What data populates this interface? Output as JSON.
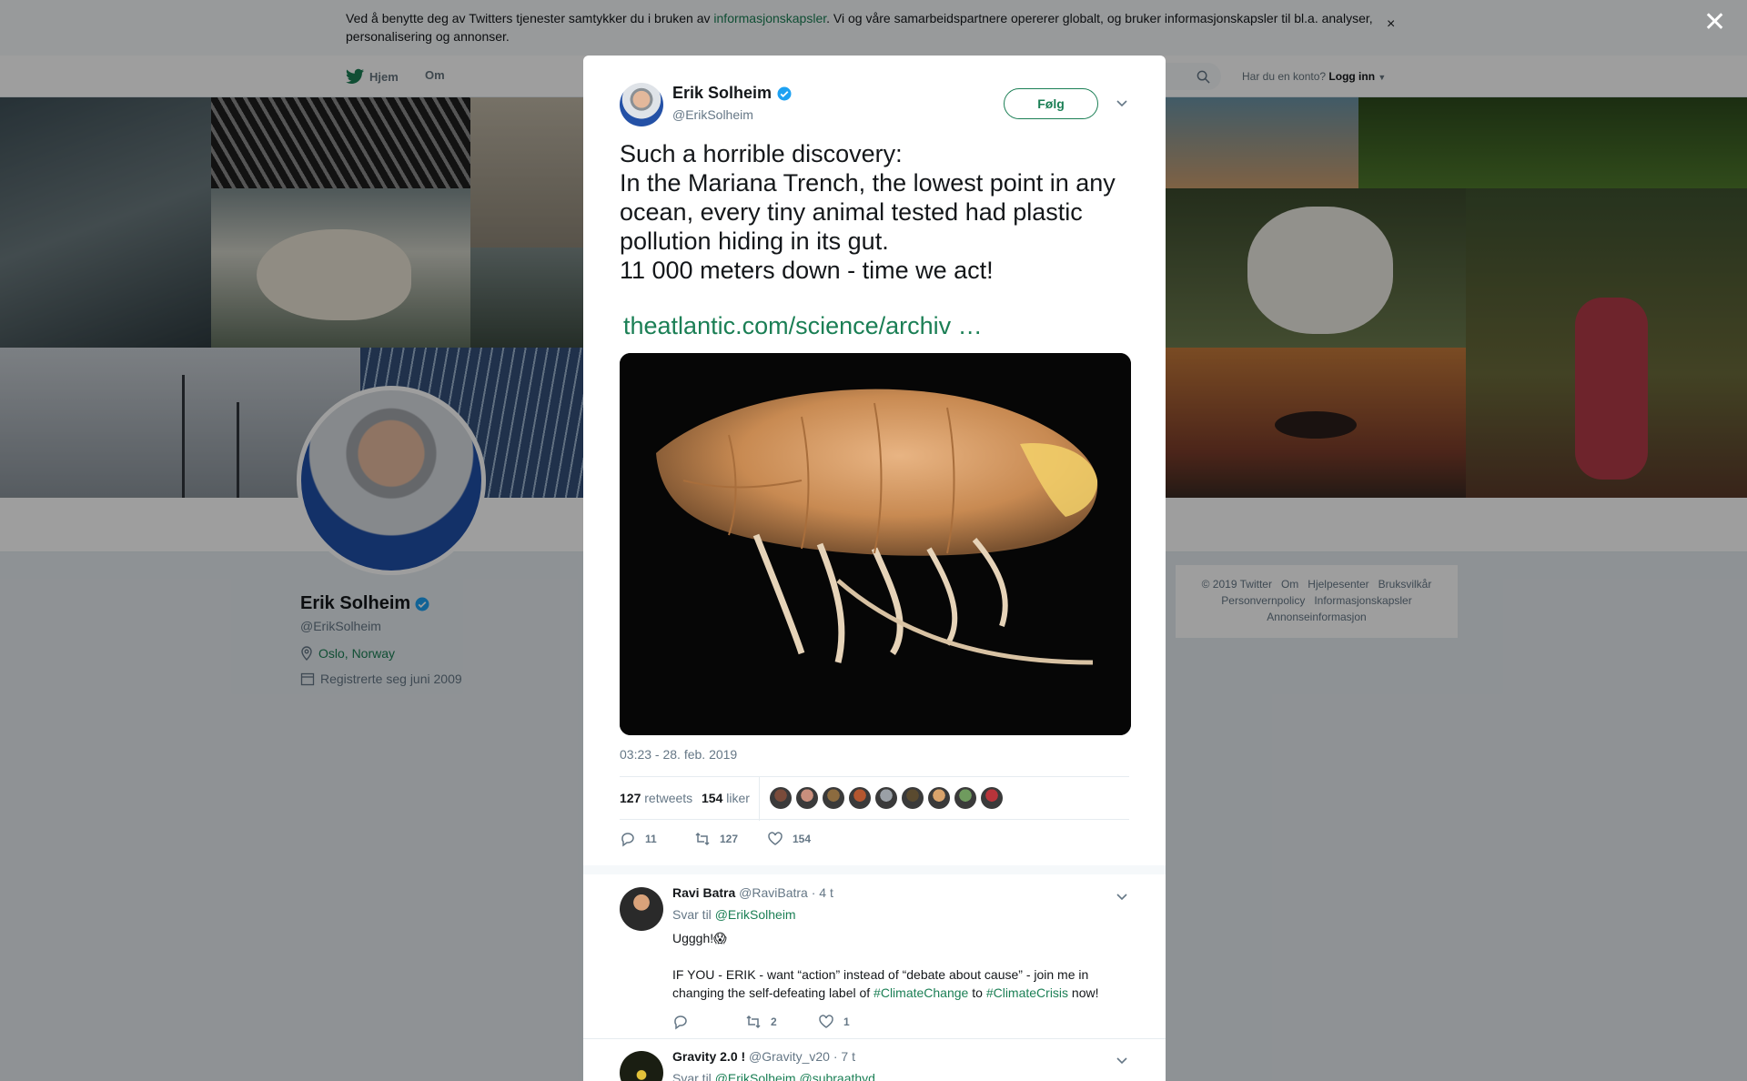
{
  "cookie": {
    "text_before": "Ved å benytte deg av Twitters tjenester samtykker du i bruken av ",
    "link": "informasjonskapsler",
    "text_after": ". Vi og våre samarbeidspartnere opererer globalt, og bruker informasjonskapsler til bl.a. analyser, personalisering og annonser.",
    "close": "×"
  },
  "nav": {
    "home": "Hjem",
    "about": "Om",
    "login_prompt": "Har du en konto?",
    "login": "Logg inn"
  },
  "profile": {
    "name": "Erik Solheim",
    "handle": "@ErikSolheim",
    "location": "Oslo, Norway",
    "joined": "Registrerte seg juni 2009"
  },
  "footer": {
    "links": [
      "© 2019 Twitter",
      "Om",
      "Hjelpesenter",
      "Bruksvilkår",
      "Personvernpolicy",
      "Informasjonskapsler",
      "Annonseinformasjon"
    ]
  },
  "overlay_close": "✕",
  "tweet": {
    "author_name": "Erik Solheim",
    "author_handle": "@ErikSolheim",
    "follow_label": "Følg",
    "text": "Such a horrible discovery:\nIn the Mariana Trench, the lowest point in any ocean, every tiny animal tested had plastic pollution hiding in its gut.\n11 000 meters down - time we act!",
    "link": "theatlantic.com/science/archiv  …",
    "timestamp": "03:23 - 28. feb. 2019",
    "retweets_count": "127",
    "retweets_label": "retweets",
    "likes_count": "154",
    "likes_label": "liker",
    "likers_colors": [
      "#7a4b3a",
      "#c98f7d",
      "#8c6b3f",
      "#b4562f",
      "#9aa0a6",
      "#5a4a2f",
      "#d9a36b",
      "#6f9b5e",
      "#b8343a"
    ],
    "actions": {
      "replies": "11",
      "retweets": "127",
      "likes": "154"
    }
  },
  "replies": [
    {
      "name": "Ravi Batra",
      "handle": "@RaviBatra",
      "time": "· 4 t",
      "reply_to_label": "Svar til",
      "reply_to": "@ErikSolheim",
      "line1": "Ugggh!😱",
      "line2_before": "IF YOU - ERIK - want “action” instead of “debate about cause” - join me in changing the self-defeating label of ",
      "hashtag1": "#ClimateChange",
      "line2_mid": " to ",
      "hashtag2": "#ClimateCrisis",
      "line2_after": " now!",
      "actions": {
        "replies": "",
        "retweets": "2",
        "likes": "1"
      }
    },
    {
      "name": "Gravity 2.0 !",
      "handle": "@Gravity_v20",
      "time": "· 7 t",
      "reply_to_label": "Svar til",
      "reply_to": "@ErikSolheim @subraathyd"
    }
  ]
}
